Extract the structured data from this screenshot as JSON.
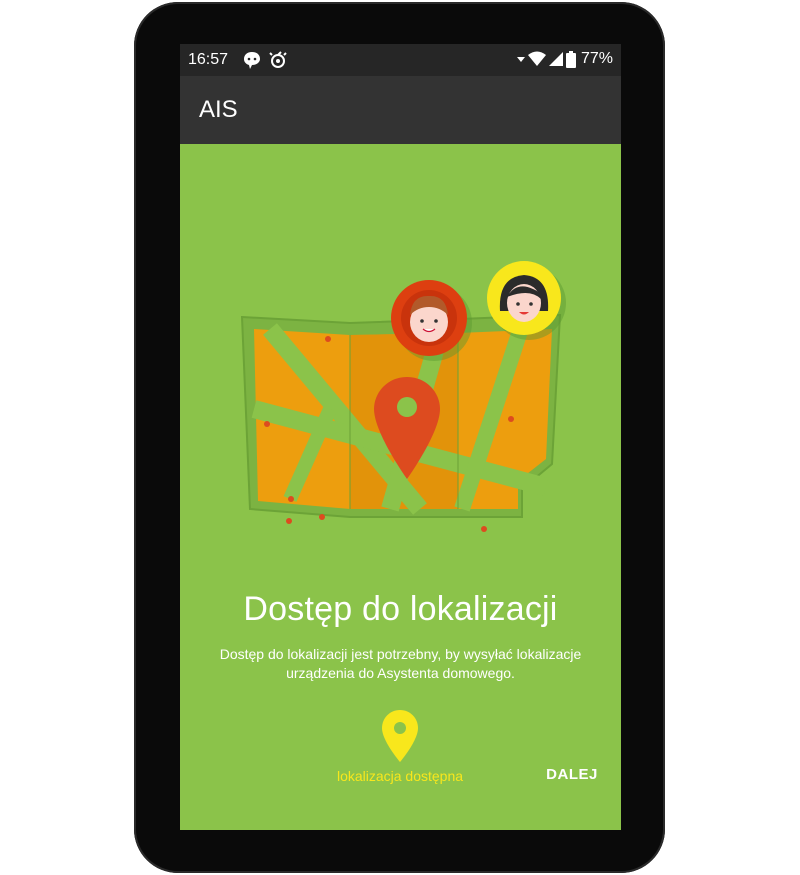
{
  "status_bar": {
    "time": "16:57",
    "battery_percent": "77%",
    "icons": [
      "chat-notification-icon",
      "sync-notification-icon",
      "wifi-icon",
      "cell-signal-icon",
      "battery-icon"
    ]
  },
  "app_bar": {
    "title": "AIS"
  },
  "onboarding": {
    "heading": "Dostęp do lokalizacji",
    "description": "Dostęp do lokalizacji jest potrzebny, by wysyłać lokalizacje urządzenia do Asystenta domowego.",
    "location_status_label": "lokalizacja dostępna",
    "next_button_label": "DALEJ"
  },
  "colors": {
    "background": "#8bc34a",
    "app_bar": "#333333",
    "status_bar": "#262626",
    "accent_yellow": "#f8e71c",
    "map_orange": "#ed9e0e",
    "pin_red": "#dd4b1f"
  },
  "illustration_icons": [
    "map-icon",
    "map-pin-icon",
    "boy-avatar-icon",
    "girl-avatar-icon"
  ]
}
